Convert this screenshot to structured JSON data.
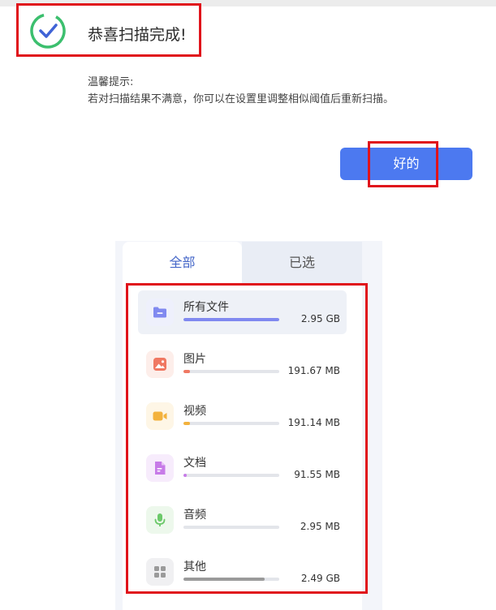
{
  "dialog": {
    "title": "恭喜扫描完成!",
    "tip_label": "温馨提示:",
    "tip_text": "若对扫描结果不满意，你可以在设置里调整相似阈值后重新扫描。",
    "ok_label": "好的",
    "accent_color": "#4c79f0",
    "success_color": "#3cbf6e"
  },
  "tabs": [
    {
      "label": "全部",
      "active": true
    },
    {
      "label": "已选",
      "active": false
    }
  ],
  "categories": [
    {
      "label": "所有文件",
      "size": "2.95 GB",
      "fraction": 1.0,
      "icon": "folder-icon",
      "color": "#8089f0",
      "bg": "#eef0fc",
      "active": true
    },
    {
      "label": "图片",
      "size": "191.67 MB",
      "fraction": 0.065,
      "icon": "image-icon",
      "color": "#f07862",
      "bg": "#fdeeea",
      "active": false
    },
    {
      "label": "视频",
      "size": "191.14 MB",
      "fraction": 0.065,
      "icon": "video-icon",
      "color": "#f3b23d",
      "bg": "#fef6e6",
      "active": false
    },
    {
      "label": "文档",
      "size": "91.55 MB",
      "fraction": 0.03,
      "icon": "document-icon",
      "color": "#c77be8",
      "bg": "#f7ecfc",
      "active": false
    },
    {
      "label": "音频",
      "size": "2.95 MB",
      "fraction": 0.0,
      "icon": "microphone-icon",
      "color": "#6cc96a",
      "bg": "#edf8ec",
      "active": false
    },
    {
      "label": "其他",
      "size": "2.49 GB",
      "fraction": 0.85,
      "icon": "grid-icon",
      "color": "#9a9a9a",
      "bg": "#f0f0f2",
      "active": false
    }
  ]
}
